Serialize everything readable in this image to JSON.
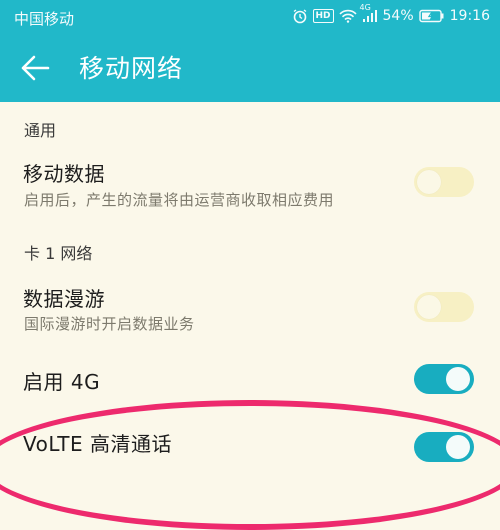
{
  "statusbar": {
    "carrier": "中国移动",
    "hd_badge": "HD",
    "network_type": "4G",
    "battery_percent": "54%",
    "time": "19:16"
  },
  "toolbar": {
    "title": "移动网络"
  },
  "sections": {
    "general_header": "通用",
    "card1_header": "卡 1 网络"
  },
  "settings": {
    "mobile_data": {
      "title": "移动数据",
      "subtitle": "启用后，产生的流量将由运营商收取相应费用",
      "state": "off-disabled"
    },
    "roaming": {
      "title": "数据漫游",
      "subtitle": "国际漫游时开启数据业务",
      "state": "off-disabled"
    },
    "enable_4g": {
      "title": "启用 4G",
      "state": "on"
    },
    "volte": {
      "title": "VoLTE 高清通话",
      "state": "on"
    }
  },
  "colors": {
    "accent": "#21b8c9",
    "toggle_on": "#18adc0",
    "annotation": "#ed2a6d",
    "background": "#fbf8ea"
  }
}
